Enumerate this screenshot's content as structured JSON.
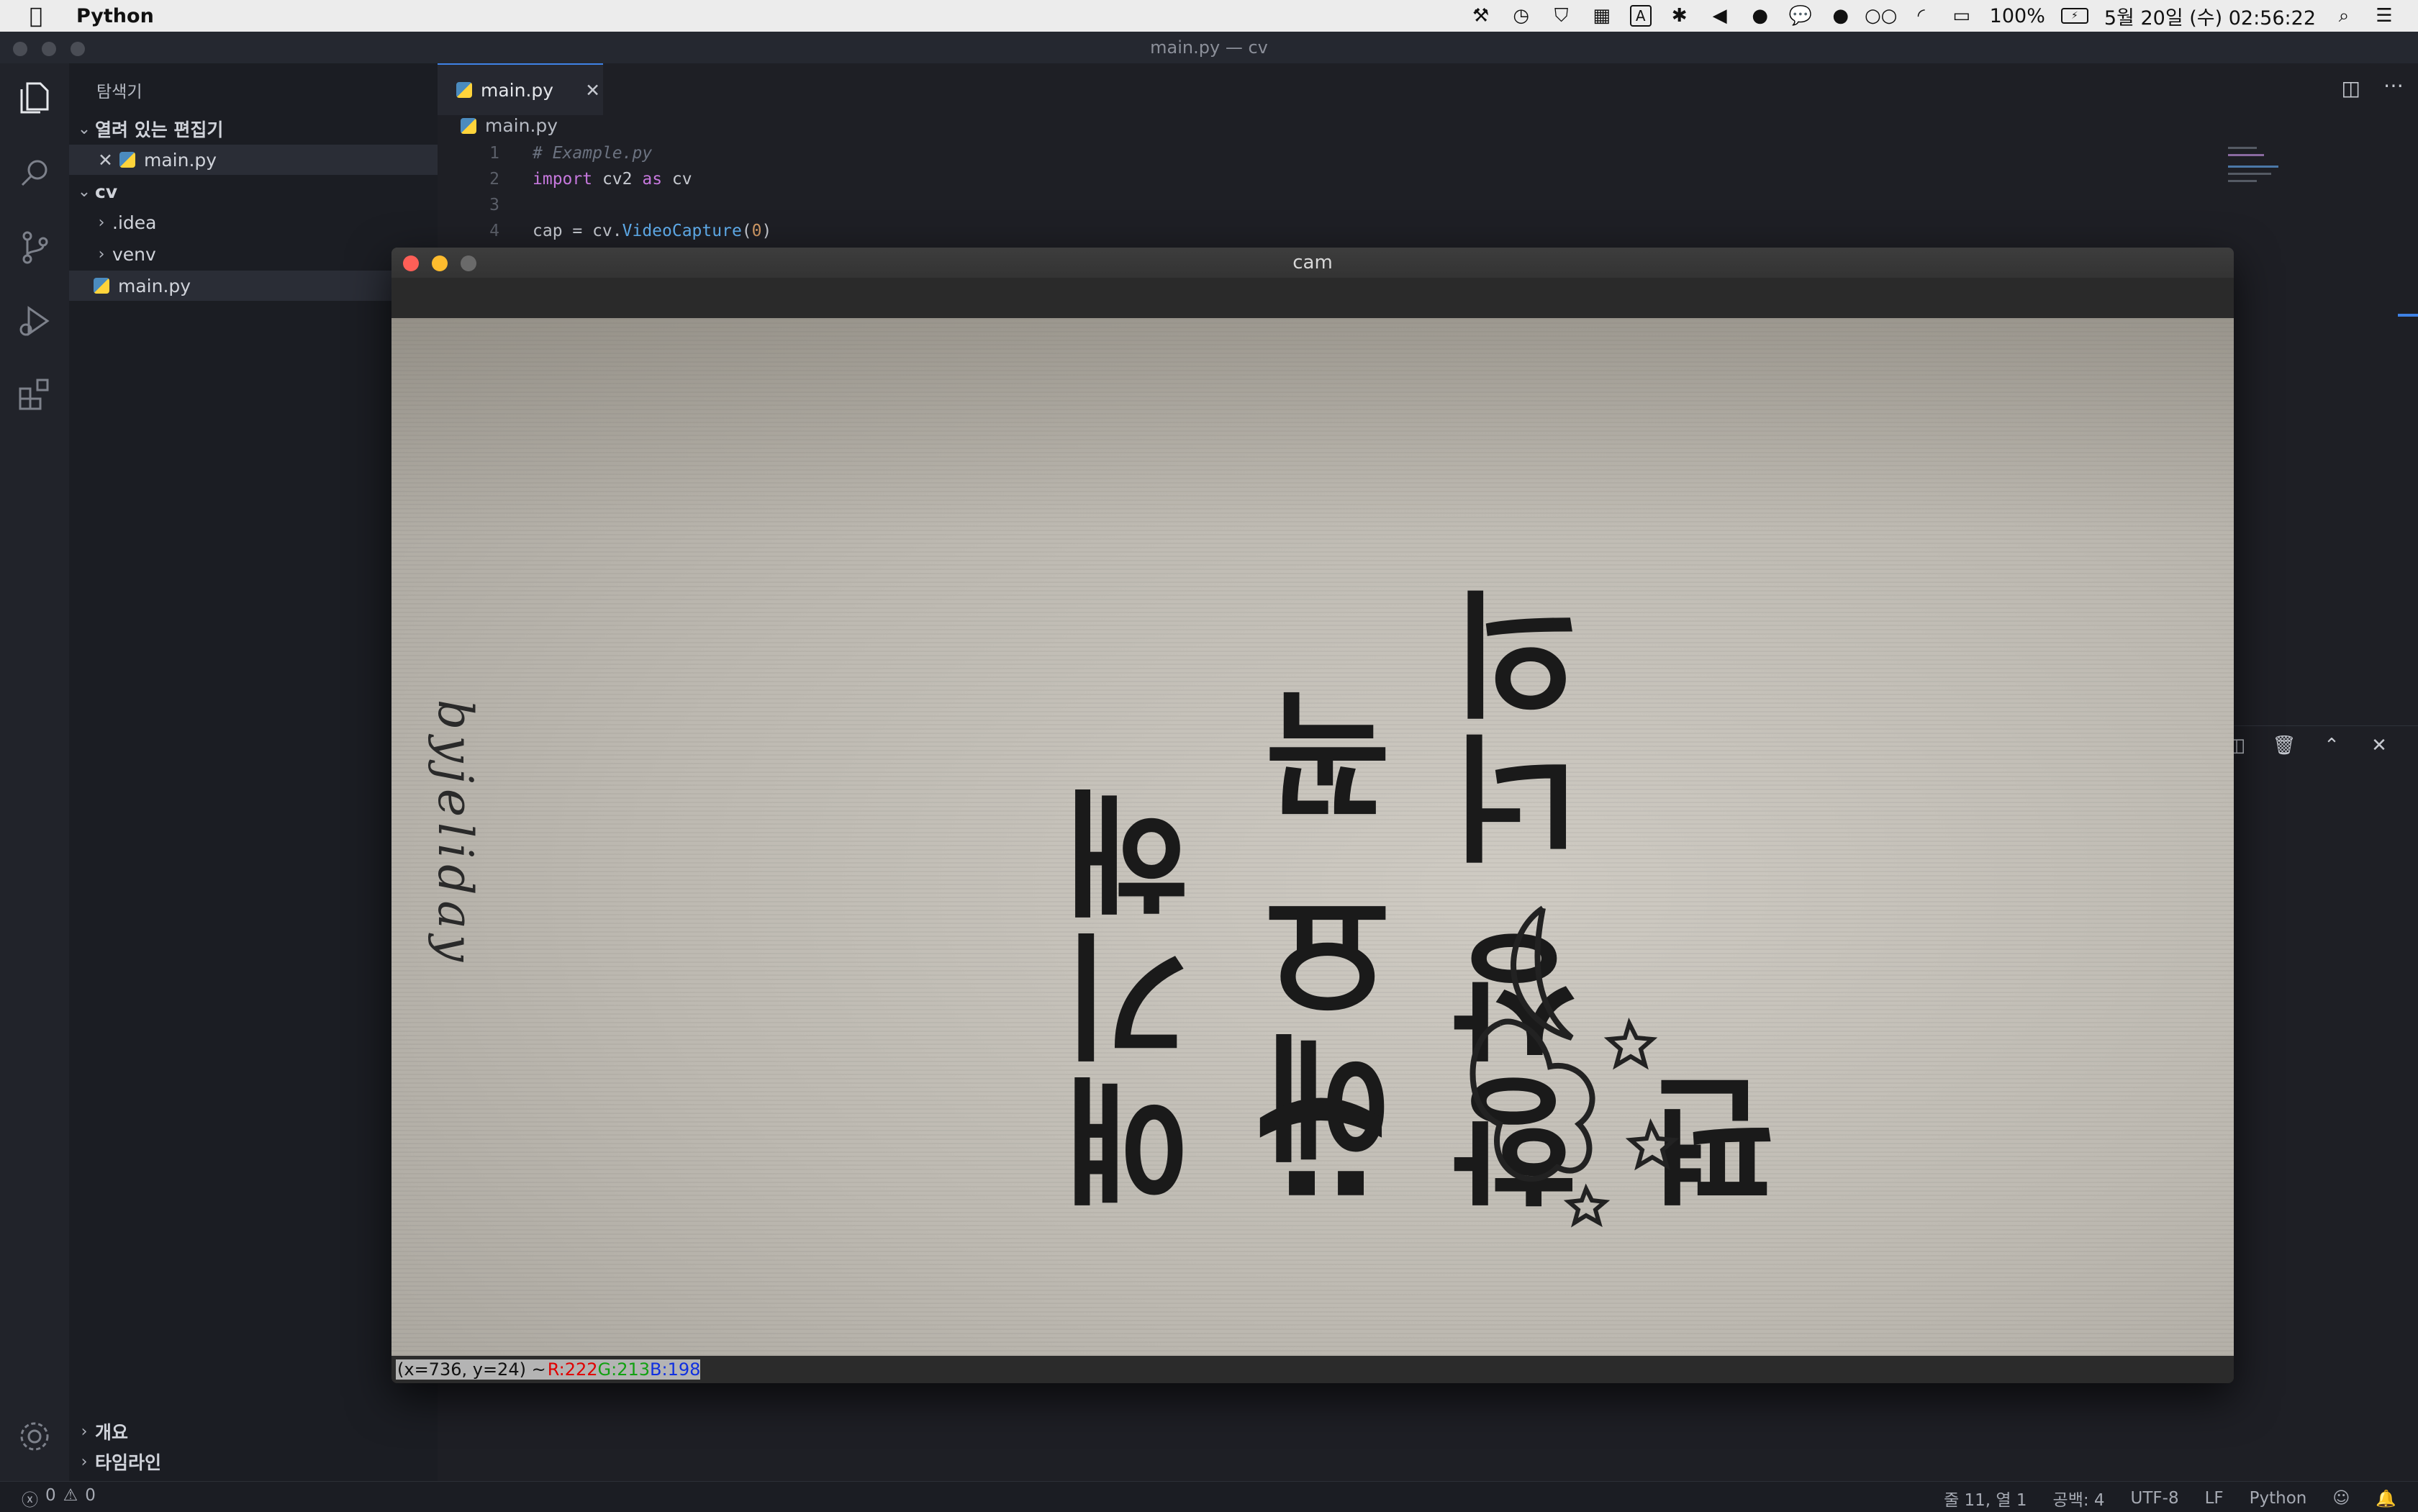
{
  "menubar": {
    "app_name": "Python",
    "battery": "100%",
    "datetime": "5월 20일 (수) 02:56:22"
  },
  "window": {
    "title": "main.py — cv"
  },
  "sidebar": {
    "title": "탐색기",
    "open_editors_label": "열려 있는 편집기",
    "open_editors": [
      {
        "name": "main.py"
      }
    ],
    "folder_name": "cv",
    "items": [
      {
        "name": ".idea",
        "type": "folder"
      },
      {
        "name": "venv",
        "type": "folder"
      },
      {
        "name": "main.py",
        "type": "file"
      }
    ],
    "outline_label": "개요",
    "timeline_label": "타임라인"
  },
  "editor": {
    "tab_label": "main.py",
    "breadcrumb": "main.py",
    "lines": [
      {
        "num": "1",
        "text": "# Example.py"
      },
      {
        "num": "2",
        "text": "import cv2 as cv"
      },
      {
        "num": "3",
        "text": ""
      },
      {
        "num": "4",
        "text": "cap = cv.VideoCapture(0)"
      }
    ]
  },
  "cam_window": {
    "title": "cam",
    "status_coords": "(x=736, y=24) ~",
    "status_r": "R:222",
    "status_g": "G:213",
    "status_b": "B:198",
    "image_text_lines": [
      "항상 너의 편",
      "에요 꼭",
      "얘기해 :)"
    ],
    "image_signature": "byjeliday"
  },
  "statusbar": {
    "errors": "0",
    "warnings": "0",
    "position": "줄 11, 열 1",
    "spaces": "공백: 4",
    "encoding": "UTF-8",
    "eol": "LF",
    "language": "Python"
  }
}
